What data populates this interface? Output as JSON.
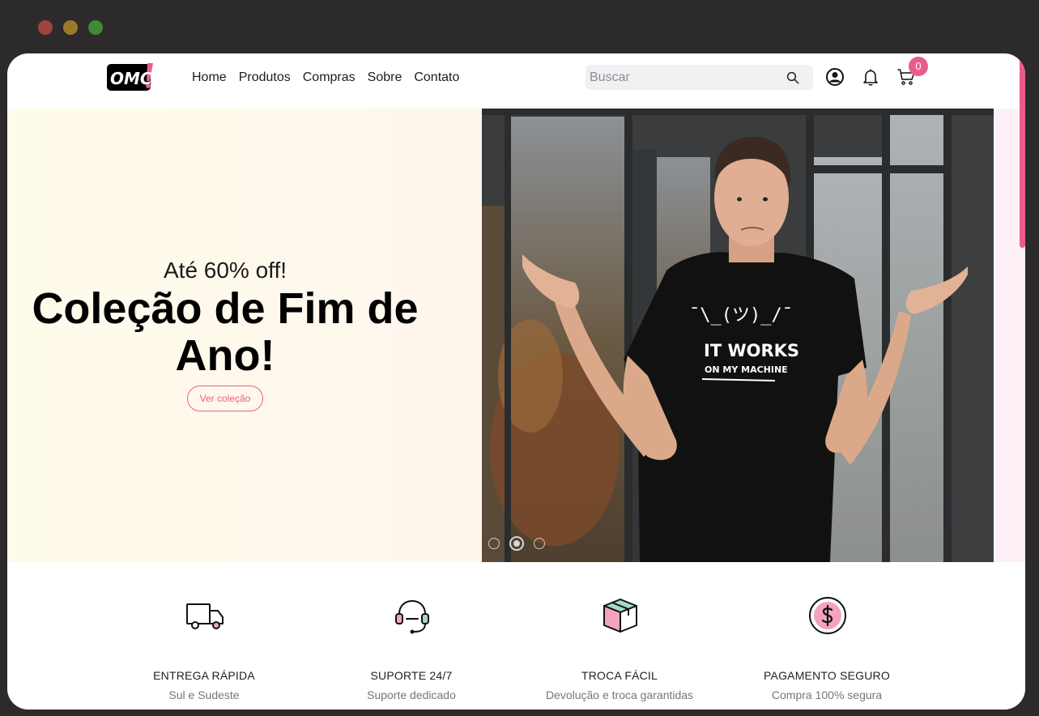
{
  "brand": {
    "logo_text": "OMC"
  },
  "nav": [
    {
      "label": "Home"
    },
    {
      "label": "Produtos"
    },
    {
      "label": "Compras"
    },
    {
      "label": "Sobre"
    },
    {
      "label": "Contato"
    }
  ],
  "search": {
    "placeholder": "Buscar",
    "icon": "search-icon"
  },
  "header_icons": {
    "user": "user-circle-icon",
    "notifications": "bell-icon",
    "cart": "cart-icon"
  },
  "cart": {
    "count": "0"
  },
  "hero": {
    "subtitle": "Até 60% off!",
    "title": "Coleção de Fim de Ano!",
    "cta_label": "Ver coleção",
    "shirt_text_line1": "IT WORKS",
    "shirt_text_line2": "ON MY MACHINE",
    "slides_total": 3,
    "active_slide": 2
  },
  "features": [
    {
      "title": "ENTREGA RÁPIDA",
      "subtitle": "Sul e Sudeste",
      "icon": "truck-icon"
    },
    {
      "title": "SUPORTE 24/7",
      "subtitle": "Suporte dedicado",
      "icon": "headset-icon"
    },
    {
      "title": "TROCA FÁCIL",
      "subtitle": "Devolução e troca garantidas",
      "icon": "box-icon"
    },
    {
      "title": "PAGAMENTO SEGURO",
      "subtitle": "Compra 100% segura",
      "icon": "dollar-coin-icon"
    }
  ],
  "colors": {
    "accent": "#ec5b8e",
    "window_frame": "#2d2a2b",
    "hero_bg": "#fffbea"
  }
}
